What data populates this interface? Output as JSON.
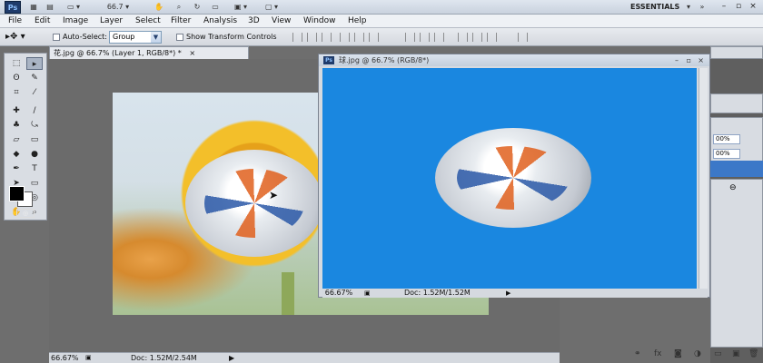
{
  "app": {
    "logo": "Ps",
    "zoom": "66.7",
    "workspace": "ESSENTIALS"
  },
  "menu": [
    "File",
    "Edit",
    "Image",
    "Layer",
    "Select",
    "Filter",
    "Analysis",
    "3D",
    "View",
    "Window",
    "Help"
  ],
  "options": {
    "auto_select_label": "Auto-Select:",
    "auto_select_value": "Group",
    "transform_label": "Show Transform Controls"
  },
  "document": {
    "tab_title": "花.jpg @ 66.7% (Layer 1, RGB/8*) *",
    "close": "×",
    "zoom_status": "66.67%",
    "doc_status": "Doc: 1.52M/2.54M"
  },
  "float_window": {
    "title": "球.jpg @ 66.7% (RGB/8*)",
    "zoom_status": "66.67%",
    "doc_status": "Doc: 1.52M/1.52M"
  },
  "right_panels": {
    "pct1": "00%",
    "pct2": "00%"
  },
  "colors": {
    "canvas_blue": "#1a87e0",
    "foreground": "#000000",
    "background": "#ffffff"
  },
  "icons": [
    "move-tool-icon",
    "marquee-tool-icon",
    "lasso-tool-icon",
    "crop-tool-icon",
    "eyedropper-icon",
    "brush-icon",
    "stamp-icon",
    "eraser-icon",
    "gradient-icon",
    "pen-icon",
    "type-icon",
    "shape-icon",
    "hand-icon",
    "zoom-icon"
  ]
}
